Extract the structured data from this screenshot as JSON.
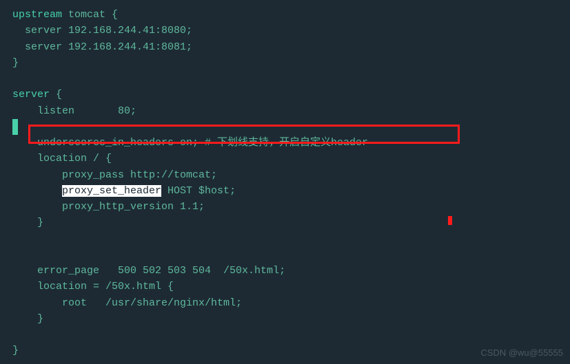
{
  "code": {
    "l1a": "upstream",
    "l1b": " tomcat {",
    "l2": "  server 192.168.244.41:8080;",
    "l3": "  server 192.168.244.41:8081;",
    "l4": "}",
    "l5": "",
    "l6a": "server",
    "l6b": " {",
    "l7": "    listen       80;",
    "l8": "",
    "l9a": "    underscores_in_headers on;",
    "l9b": " # 下划线支持，开启自定义header",
    "l10": "    location / {",
    "l11": "        proxy_pass http://tomcat;",
    "l12a": "        ",
    "l12b": "proxy_set_header",
    "l12c": " HOST $host;",
    "l13": "        proxy_http_version 1.1;",
    "l14": "    }",
    "l15": "",
    "l16": "",
    "l17": "    error_page   500 502 503 504  /50x.html;",
    "l18": "    location = /50x.html {",
    "l19": "        root   /usr/share/nginx/html;",
    "l20": "    }",
    "l21": "",
    "l22": "}"
  },
  "watermark": "CSDN @wu@55555"
}
